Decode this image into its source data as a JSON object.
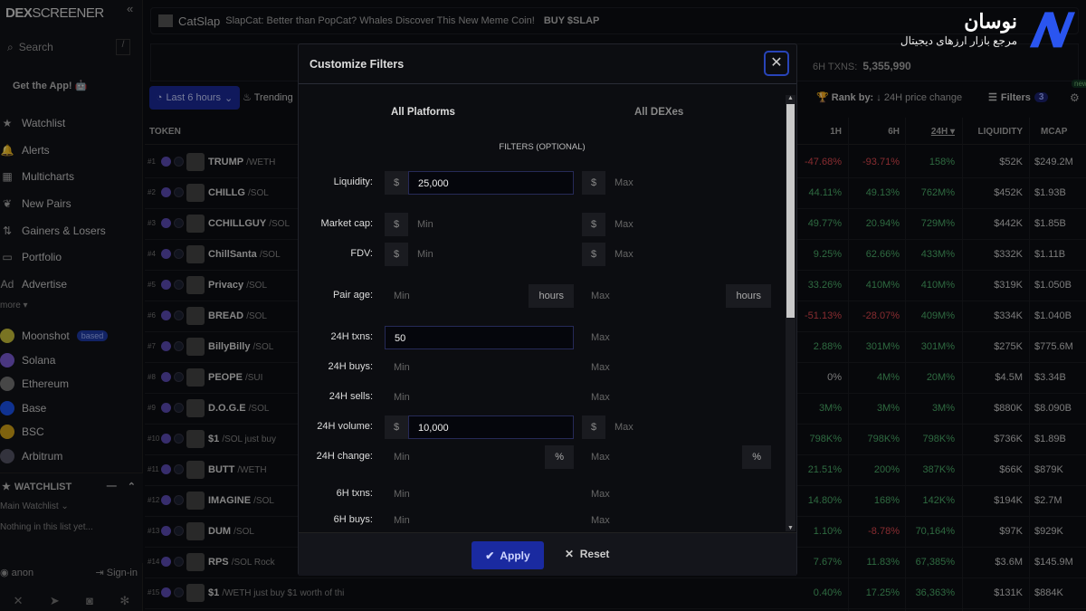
{
  "sidebar": {
    "logo_bold": "DEX",
    "logo_rest": "SCREENER",
    "search_placeholder": "Search",
    "search_shortcut": "/",
    "get_app": "Get the App!",
    "items": [
      {
        "label": "Watchlist",
        "icon": "★"
      },
      {
        "label": "Alerts",
        "icon": "🔔"
      },
      {
        "label": "Multicharts",
        "icon": "▦"
      },
      {
        "label": "New Pairs",
        "icon": "❦"
      },
      {
        "label": "Gainers & Losers",
        "icon": "⇅"
      },
      {
        "label": "Portfolio",
        "icon": "▭"
      },
      {
        "label": "Advertise",
        "icon": "Ad"
      }
    ],
    "more": "more ▾",
    "chains": [
      {
        "label": "Moonshot",
        "color": "#c9c23a",
        "badge": "based"
      },
      {
        "label": "Solana",
        "color": "#7b5cd6"
      },
      {
        "label": "Ethereum",
        "color": "#777"
      },
      {
        "label": "Base",
        "color": "#1a54f0"
      },
      {
        "label": "BSC",
        "color": "#d4a418"
      },
      {
        "label": "Arbitrum",
        "color": "#556"
      }
    ],
    "watchlist": {
      "title": "WATCHLIST",
      "list": "Main Watchlist",
      "empty": "Nothing in this list yet..."
    },
    "user": "anon",
    "signin": "Sign-in"
  },
  "banner": {
    "name": "CatSlap",
    "text": "SlapCat: Better than PopCat? Whales Discover This New Meme Coin!",
    "cta": "BUY $SLAP"
  },
  "stats": {
    "label": "6H TXNS:",
    "value": "5,355,990"
  },
  "toolbar": {
    "time": "Last 6 hours",
    "trending": "Trending",
    "rank_label": "Rank by:",
    "rank_value": "24H price change",
    "filters": "Filters",
    "filters_count": "3",
    "new_badge": "new"
  },
  "table": {
    "headers": {
      "token": "TOKEN",
      "h1": "1H",
      "h6": "6H",
      "h24": "24H",
      "liquidity": "LIQUIDITY",
      "mcap": "MCAP"
    },
    "rows": [
      {
        "rank": "#1",
        "token": "TRUMP",
        "quote": "/WETH",
        "h1": "-47.68%",
        "h6": "-93.71%",
        "h24": "158%",
        "liq": "$52K",
        "mcap": "$249.2M"
      },
      {
        "rank": "#2",
        "token": "CHILLG",
        "quote": "/SOL",
        "h1": "44.11%",
        "h6": "49.13%",
        "h24": "762M%",
        "liq": "$452K",
        "mcap": "$1.93B"
      },
      {
        "rank": "#3",
        "token": "CCHILLGUY",
        "quote": "/SOL",
        "h1": "49.77%",
        "h6": "20.94%",
        "h24": "729M%",
        "liq": "$442K",
        "mcap": "$1.85B"
      },
      {
        "rank": "#4",
        "token": "ChillSanta",
        "quote": "/SOL",
        "h1": "9.25%",
        "h6": "62.66%",
        "h24": "433M%",
        "liq": "$332K",
        "mcap": "$1.11B"
      },
      {
        "rank": "#5",
        "token": "Privacy",
        "quote": "/SOL",
        "h1": "33.26%",
        "h6": "410M%",
        "h24": "410M%",
        "liq": "$319K",
        "mcap": "$1.050B"
      },
      {
        "rank": "#6",
        "token": "BREAD",
        "quote": "/SOL",
        "h1": "-51.13%",
        "h6": "-28.07%",
        "h24": "409M%",
        "liq": "$334K",
        "mcap": "$1.040B"
      },
      {
        "rank": "#7",
        "token": "BillyBilly",
        "quote": "/SOL",
        "h1": "2.88%",
        "h6": "301M%",
        "h24": "301M%",
        "liq": "$275K",
        "mcap": "$775.6M"
      },
      {
        "rank": "#8",
        "token": "PEOPE",
        "quote": "/SUI",
        "h1": "0%",
        "h6": "4M%",
        "h24": "20M%",
        "liq": "$4.5M",
        "mcap": "$3.34B"
      },
      {
        "rank": "#9",
        "token": "D.O.G.E",
        "quote": "/SOL",
        "h1": "3M%",
        "h6": "3M%",
        "h24": "3M%",
        "liq": "$880K",
        "mcap": "$8.090B"
      },
      {
        "rank": "#10",
        "token": "$1",
        "quote": "/SOL just buy",
        "h1": "798K%",
        "h6": "798K%",
        "h24": "798K%",
        "liq": "$736K",
        "mcap": "$1.89B"
      },
      {
        "rank": "#11",
        "token": "BUTT",
        "quote": "/WETH",
        "h1": "21.51%",
        "h6": "200%",
        "h24": "387K%",
        "liq": "$66K",
        "mcap": "$879K"
      },
      {
        "rank": "#12",
        "token": "IMAGINE",
        "quote": "/SOL",
        "h1": "14.80%",
        "h6": "168%",
        "h24": "142K%",
        "liq": "$194K",
        "mcap": "$2.7M"
      },
      {
        "rank": "#13",
        "token": "DUM",
        "quote": "/SOL",
        "h1": "1.10%",
        "h6": "-8.78%",
        "h24": "70,164%",
        "liq": "$97K",
        "mcap": "$929K"
      },
      {
        "rank": "#14",
        "token": "RPS",
        "quote": "/SOL Rock",
        "h1": "7.67%",
        "h6": "11.83%",
        "h24": "67,385%",
        "liq": "$3.6M",
        "mcap": "$145.9M"
      },
      {
        "rank": "#15",
        "token": "$1",
        "quote": "/WETH just buy $1 worth of thi",
        "h1": "0.40%",
        "h6": "17.25%",
        "h24": "36,363%",
        "liq": "$131K",
        "mcap": "$884K"
      }
    ]
  },
  "watermark": {
    "title": "نوسان",
    "subtitle": "مرجع بازار ارزهای دیجیتال"
  },
  "modal": {
    "title": "Customize Filters",
    "tab_platforms": "All Platforms",
    "tab_dexes": "All DEXes",
    "section": "FILTERS (OPTIONAL)",
    "rows": [
      {
        "label": "Liquidity:",
        "min_prefix": "$",
        "min": "25,000",
        "max_prefix": "$",
        "max_placeholder": "Max"
      },
      {
        "label": "Market cap:",
        "min_prefix": "$",
        "min_placeholder": "Min",
        "max_prefix": "$",
        "max_placeholder": "Max"
      },
      {
        "label": "FDV:",
        "min_prefix": "$",
        "min_placeholder": "Min",
        "max_prefix": "$",
        "max_placeholder": "Max"
      },
      {
        "label": "Pair age:",
        "min_placeholder": "Min",
        "min_suffix": "hours",
        "max_placeholder": "Max",
        "max_suffix": "hours"
      },
      {
        "label": "24H txns:",
        "min": "50",
        "max_placeholder": "Max"
      },
      {
        "label": "24H buys:",
        "min_placeholder": "Min",
        "max_placeholder": "Max"
      },
      {
        "label": "24H sells:",
        "min_placeholder": "Min",
        "max_placeholder": "Max"
      },
      {
        "label": "24H volume:",
        "min_prefix": "$",
        "min": "10,000",
        "max_prefix": "$",
        "max_placeholder": "Max"
      },
      {
        "label": "24H change:",
        "min_placeholder": "Min",
        "min_suffix": "%",
        "max_placeholder": "Max",
        "max_suffix": "%"
      },
      {
        "label": "6H txns:",
        "min_placeholder": "Min",
        "max_placeholder": "Max"
      },
      {
        "label": "6H buys:",
        "min_placeholder": "Min",
        "max_placeholder": "Max"
      }
    ],
    "apply": "Apply",
    "reset": "Reset"
  },
  "colors": {
    "accent": "#1a2aa0",
    "positive": "#4caf6a",
    "negative": "#e0484f"
  }
}
